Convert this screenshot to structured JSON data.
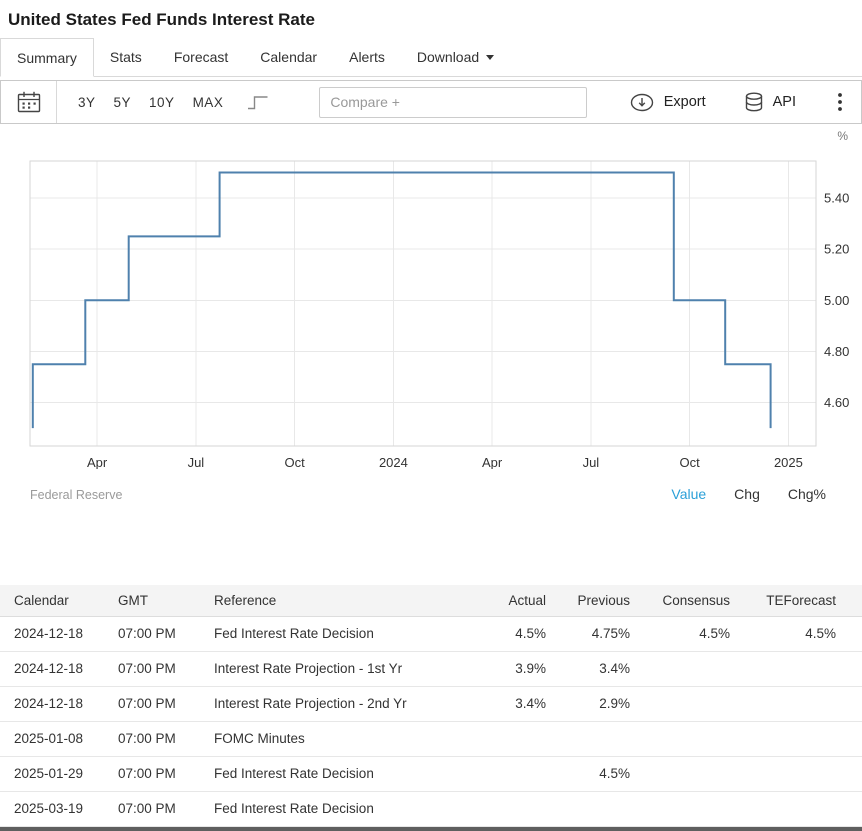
{
  "header": {
    "title": "United States Fed Funds Interest Rate"
  },
  "tabs": {
    "items": [
      {
        "label": "Summary",
        "active": true,
        "has_dropdown": false
      },
      {
        "label": "Stats",
        "active": false,
        "has_dropdown": false
      },
      {
        "label": "Forecast",
        "active": false,
        "has_dropdown": false
      },
      {
        "label": "Calendar",
        "active": false,
        "has_dropdown": false
      },
      {
        "label": "Alerts",
        "active": false,
        "has_dropdown": false
      },
      {
        "label": "Download",
        "active": false,
        "has_dropdown": true
      }
    ]
  },
  "toolbar": {
    "range_buttons": [
      "3Y",
      "5Y",
      "10Y",
      "MAX"
    ],
    "compare": {
      "placeholder": "Compare +"
    },
    "export_label": "Export",
    "api_label": "API"
  },
  "colors": {
    "accent_blue": "#2ba0d8",
    "chart_line": "#4f81ad"
  },
  "chart_data": {
    "type": "line",
    "step": true,
    "title": "United States Fed Funds Interest Rate",
    "ylabel": "%",
    "unit": "%",
    "grid": true,
    "legend": false,
    "line_color": "#4f81ad",
    "x_domain": [
      2023.08,
      2025.07
    ],
    "y_domain": [
      4.43,
      5.545
    ],
    "y_ticks": [
      4.6,
      4.8,
      5.0,
      5.2,
      5.4
    ],
    "x_ticks": [
      {
        "x": 2023.25,
        "label": "Apr"
      },
      {
        "x": 2023.5,
        "label": "Jul"
      },
      {
        "x": 2023.75,
        "label": "Oct"
      },
      {
        "x": 2024.0,
        "label": "2024"
      },
      {
        "x": 2024.25,
        "label": "Apr"
      },
      {
        "x": 2024.5,
        "label": "Jul"
      },
      {
        "x": 2024.75,
        "label": "Oct"
      },
      {
        "x": 2025.0,
        "label": "2025"
      }
    ],
    "series": [
      {
        "name": "Fed Funds Interest Rate",
        "start": {
          "x": 2023.087,
          "value": 4.5
        },
        "changes": [
          {
            "x": 2023.087,
            "value": 4.75
          },
          {
            "x": 2023.22,
            "value": 5.0
          },
          {
            "x": 2023.33,
            "value": 5.25
          },
          {
            "x": 2023.56,
            "value": 5.5
          },
          {
            "x": 2024.71,
            "value": 5.0
          },
          {
            "x": 2024.84,
            "value": 4.75
          },
          {
            "x": 2024.955,
            "value": 4.5
          }
        ]
      }
    ]
  },
  "chart_footer": {
    "source": "Federal Reserve",
    "modes": [
      {
        "label": "Value",
        "active": true
      },
      {
        "label": "Chg",
        "active": false
      },
      {
        "label": "Chg%",
        "active": false
      }
    ]
  },
  "calendar_table": {
    "headers": [
      "Calendar",
      "GMT",
      "Reference",
      "Actual",
      "Previous",
      "Consensus",
      "TEForecast"
    ],
    "rows": [
      {
        "calendar": "2024-12-18",
        "gmt": "07:00 PM",
        "reference": "Fed Interest Rate Decision",
        "actual": "4.5%",
        "previous": "4.75%",
        "consensus": "4.5%",
        "teforecast": "4.5%"
      },
      {
        "calendar": "2024-12-18",
        "gmt": "07:00 PM",
        "reference": "Interest Rate Projection - 1st Yr",
        "actual": "3.9%",
        "previous": "3.4%",
        "consensus": "",
        "teforecast": ""
      },
      {
        "calendar": "2024-12-18",
        "gmt": "07:00 PM",
        "reference": "Interest Rate Projection - 2nd Yr",
        "actual": "3.4%",
        "previous": "2.9%",
        "consensus": "",
        "teforecast": ""
      },
      {
        "calendar": "2025-01-08",
        "gmt": "07:00 PM",
        "reference": "FOMC Minutes",
        "actual": "",
        "previous": "",
        "consensus": "",
        "teforecast": ""
      },
      {
        "calendar": "2025-01-29",
        "gmt": "07:00 PM",
        "reference": "Fed Interest Rate Decision",
        "actual": "",
        "previous": "4.5%",
        "consensus": "",
        "teforecast": ""
      },
      {
        "calendar": "2025-03-19",
        "gmt": "07:00 PM",
        "reference": "Fed Interest Rate Decision",
        "actual": "",
        "previous": "",
        "consensus": "",
        "teforecast": ""
      }
    ]
  }
}
